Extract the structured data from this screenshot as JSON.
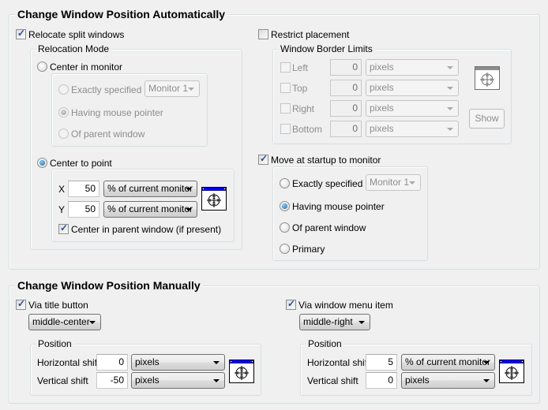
{
  "auto": {
    "title": "Change Window Position Automatically",
    "relocate_split": {
      "label": "Relocate split windows",
      "checked": true
    },
    "relocation_mode": {
      "title": "Relocation Mode",
      "center_in_monitor": {
        "label": "Center in monitor",
        "selected": false
      },
      "monitor_options": {
        "exactly_specified": "Exactly specified",
        "monitor_select": "Monitor 1",
        "having_mouse_pointer": "Having mouse pointer",
        "of_parent_window": "Of parent window",
        "selected": "having_mouse_pointer"
      },
      "center_to_point": {
        "label": "Center to point",
        "selected": true
      },
      "point": {
        "x_label": "X",
        "x_value": "50",
        "x_unit": "% of current monitor",
        "y_label": "Y",
        "y_value": "50",
        "y_unit": "% of current monitor",
        "center_parent": {
          "label": "Center in parent window (if present)",
          "checked": true
        }
      }
    },
    "restrict": {
      "label": "Restrict placement",
      "checked": false
    },
    "border_limits": {
      "title": "Window Border Limits",
      "rows": [
        {
          "label": "Left",
          "value": "0",
          "unit": "pixels",
          "checked": false
        },
        {
          "label": "Top",
          "value": "0",
          "unit": "pixels",
          "checked": false
        },
        {
          "label": "Right",
          "value": "0",
          "unit": "pixels",
          "checked": false
        },
        {
          "label": "Bottom",
          "value": "0",
          "unit": "pixels",
          "checked": false
        }
      ],
      "show_button": "Show"
    },
    "move_startup": {
      "label": "Move at startup to monitor",
      "checked": true,
      "exactly_specified": "Exactly specified",
      "monitor_select": "Monitor 1",
      "having_mouse_pointer": "Having mouse pointer",
      "of_parent_window": "Of parent window",
      "primary": "Primary",
      "selected": "having_mouse_pointer"
    }
  },
  "manual": {
    "title": "Change Window Position Manually",
    "title_button": {
      "label": "Via title button",
      "checked": true,
      "anchor": "middle-center",
      "position_title": "Position",
      "h_label": "Horizontal shift",
      "h_value": "0",
      "h_unit": "pixels",
      "v_label": "Vertical shift",
      "v_value": "-50",
      "v_unit": "pixels"
    },
    "menu_item": {
      "label": "Via window menu item",
      "checked": true,
      "anchor": "middle-right",
      "position_title": "Position",
      "h_label": "Horizontal shift",
      "h_value": "5",
      "h_unit": "% of current monitor",
      "v_label": "Vertical shift",
      "v_value": "0",
      "v_unit": "pixels"
    }
  },
  "colors": {
    "accent_blue": "#0000ff",
    "radio_selected": "#1b5fa8"
  }
}
